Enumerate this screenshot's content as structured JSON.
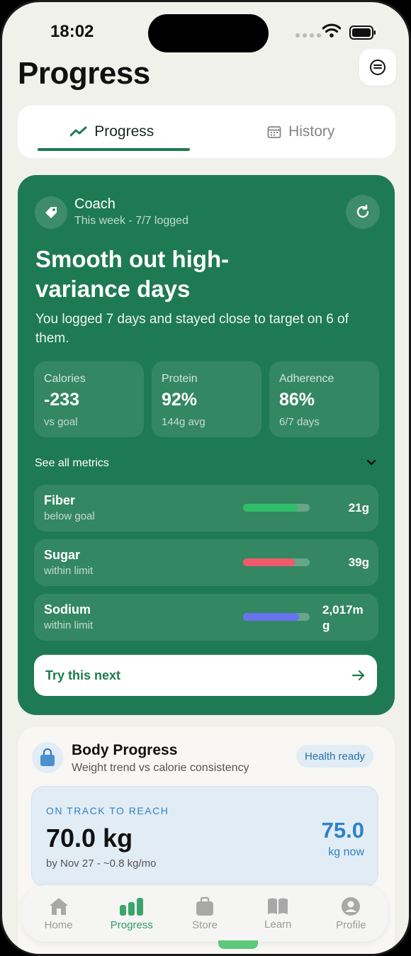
{
  "status_bar": {
    "time": "18:02"
  },
  "header": {
    "title": "Progress"
  },
  "tabs": [
    {
      "label": "Progress",
      "icon": "trend-line-icon",
      "active": true
    },
    {
      "label": "History",
      "icon": "calendar-icon",
      "active": false
    }
  ],
  "coach": {
    "name": "Coach",
    "week": "This week - 7/7 logged",
    "headline": "Smooth out high-variance days",
    "summary": "You logged 7 days and stayed close to target on 6 of them.",
    "stats": [
      {
        "label": "Calories",
        "value": "-233",
        "sub": "vs goal"
      },
      {
        "label": "Protein",
        "value": "92%",
        "sub": "144g avg"
      },
      {
        "label": "Adherence",
        "value": "86%",
        "sub": "6/7 days"
      }
    ],
    "see_all": "See all metrics",
    "metrics": [
      {
        "name": "Fiber",
        "status": "below goal",
        "value": "21g",
        "progress": 0.82,
        "color": "#2fbf6a"
      },
      {
        "name": "Sugar",
        "status": "within limit",
        "value": "39g",
        "progress": 0.78,
        "color": "#f05a6a"
      },
      {
        "name": "Sodium",
        "status": "within limit",
        "value": "2,017mg",
        "progress": 0.84,
        "color": "#6a72f0"
      }
    ],
    "try_next": "Try this next"
  },
  "body_progress": {
    "title": "Body Progress",
    "subtitle": "Weight trend vs calorie consistency",
    "badge": "Health ready",
    "track_label": "ON TRACK TO REACH",
    "goal_weight": "70.0 kg",
    "by_date": "by Nov 27 - ~0.8 kg/mo",
    "current_weight": "75.0",
    "current_label": "kg now"
  },
  "nav": [
    {
      "label": "Home",
      "icon": "home-icon",
      "active": false
    },
    {
      "label": "Progress",
      "icon": "bar-chart-icon",
      "active": true
    },
    {
      "label": "Store",
      "icon": "briefcase-icon",
      "active": false
    },
    {
      "label": "Learn",
      "icon": "book-icon",
      "active": false
    },
    {
      "label": "Profile",
      "icon": "profile-icon",
      "active": false
    }
  ],
  "colors": {
    "brand_green": "#1e7a52",
    "accent_blue": "#2b83c9",
    "nav_active": "#2e9a62"
  }
}
